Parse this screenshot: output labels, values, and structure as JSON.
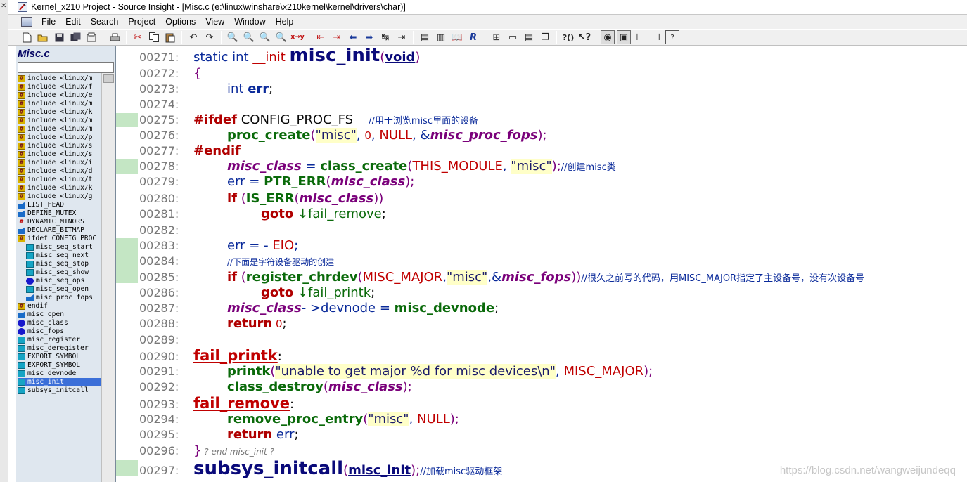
{
  "window": {
    "title": "Kernel_x210 Project - Source Insight - [Misc.c (e:\\linux\\winshare\\x210kernel\\kernel\\drivers\\char)]"
  },
  "menu": [
    "File",
    "Edit",
    "Search",
    "Project",
    "Options",
    "View",
    "Window",
    "Help"
  ],
  "symbol_pane": {
    "file_name": "Misc.c",
    "search_value": "",
    "items": [
      {
        "label": "include <linux/m",
        "icon": "include-icon"
      },
      {
        "label": "include <linux/f",
        "icon": "include-icon"
      },
      {
        "label": "include <linux/e",
        "icon": "include-icon"
      },
      {
        "label": "include <linux/m",
        "icon": "include-icon"
      },
      {
        "label": "include <linux/k",
        "icon": "include-icon"
      },
      {
        "label": "include <linux/m",
        "icon": "include-icon"
      },
      {
        "label": "include <linux/m",
        "icon": "include-icon"
      },
      {
        "label": "include <linux/p",
        "icon": "include-icon"
      },
      {
        "label": "include <linux/s",
        "icon": "include-icon"
      },
      {
        "label": "include <linux/s",
        "icon": "include-icon"
      },
      {
        "label": "include <linux/i",
        "icon": "include-icon"
      },
      {
        "label": "include <linux/d",
        "icon": "include-icon"
      },
      {
        "label": "include <linux/t",
        "icon": "include-icon"
      },
      {
        "label": "include <linux/k",
        "icon": "include-icon"
      },
      {
        "label": "include <linux/g",
        "icon": "include-icon"
      },
      {
        "label": "LIST_HEAD",
        "icon": "macro-icon"
      },
      {
        "label": "DEFINE_MUTEX",
        "icon": "macro-icon"
      },
      {
        "label": "DYNAMIC_MINORS",
        "icon": "define-icon"
      },
      {
        "label": "DECLARE_BITMAP",
        "icon": "macro-icon"
      },
      {
        "label": "ifdef CONFIG_PROC",
        "icon": "include-icon"
      },
      {
        "label": "misc_seq_start",
        "icon": "function-icon",
        "indent": true
      },
      {
        "label": "misc_seq_next",
        "icon": "function-icon",
        "indent": true
      },
      {
        "label": "misc_seq_stop",
        "icon": "function-icon",
        "indent": true
      },
      {
        "label": "misc_seq_show",
        "icon": "function-icon",
        "indent": true
      },
      {
        "label": "misc_seq_ops",
        "icon": "variable-icon",
        "indent": true
      },
      {
        "label": "misc_seq_open",
        "icon": "function-icon",
        "indent": true
      },
      {
        "label": "misc_proc_fops",
        "icon": "macro-icon",
        "indent": true
      },
      {
        "label": "endif",
        "icon": "include-icon"
      },
      {
        "label": "misc_open",
        "icon": "macro-icon"
      },
      {
        "label": "misc_class",
        "icon": "variable-icon"
      },
      {
        "label": "misc_fops",
        "icon": "variable-icon"
      },
      {
        "label": "misc_register",
        "icon": "function-icon"
      },
      {
        "label": "misc_deregister",
        "icon": "function-icon"
      },
      {
        "label": "EXPORT_SYMBOL",
        "icon": "function-icon"
      },
      {
        "label": "EXPORT_SYMBOL",
        "icon": "function-icon"
      },
      {
        "label": "misc_devnode",
        "icon": "function-icon"
      },
      {
        "label": "misc_init",
        "icon": "function-icon",
        "selected": true
      },
      {
        "label": "subsys_initcall",
        "icon": "function-icon"
      }
    ]
  },
  "code": {
    "l271": {
      "n": "00271:",
      "a": "static int ",
      "b": "__init ",
      "c": "misc_init",
      "d": "(",
      "e": "void",
      "f": ")"
    },
    "l272": {
      "n": "00272:",
      "a": "{"
    },
    "l273": {
      "n": "00273:",
      "a": "int ",
      "b": "err",
      "c": ";"
    },
    "l274": {
      "n": "00274:"
    },
    "l275": {
      "n": "00275:",
      "a": "#ifdef",
      "b": " CONFIG_PROC_FS",
      "c": "//用于浏览misc里面的设备"
    },
    "l276": {
      "n": "00276:",
      "a": "proc_create",
      "b": "(",
      "c": "\"misc\"",
      "d": ", ",
      "e": "0",
      "f": ", ",
      "g": "NULL",
      "h": ", &",
      "i": "misc_proc_fops",
      "j": ");"
    },
    "l277": {
      "n": "00277:",
      "a": "#endif"
    },
    "l278": {
      "n": "00278:",
      "a": "misc_class",
      "b": " = ",
      "c": "class_create",
      "d": "(",
      "e": "THIS_MODULE",
      "f": ", ",
      "g": "\"misc\"",
      "h": ");",
      "i": "//创建misc类"
    },
    "l279": {
      "n": "00279:",
      "a": "err",
      "b": " = ",
      "c": "PTR_ERR",
      "d": "(",
      "e": "misc_class",
      "f": ");"
    },
    "l280": {
      "n": "00280:",
      "a": "if",
      "b": " (",
      "c": "IS_ERR",
      "d": "(",
      "e": "misc_class",
      "f": "))"
    },
    "l281": {
      "n": "00281:",
      "a": "goto",
      "b": " ↓fail_remove",
      "c": ";"
    },
    "l282": {
      "n": "00282:"
    },
    "l283": {
      "n": "00283:",
      "a": "err",
      "b": " = - ",
      "c": "EIO",
      "d": ";"
    },
    "l284": {
      "n": "00284:",
      "a": "//下面是字符设备驱动的创建"
    },
    "l285": {
      "n": "00285:",
      "a": "if",
      "b": " (",
      "c": "register_chrdev",
      "d": "(",
      "e": "MISC_MAJOR",
      "f": ",",
      "g": "\"misc\"",
      "h": ",&",
      "i": "misc_fops",
      "j": "))",
      "k": "//很久之前写的代码，用MISC_MAJOR指定了主设备号，没有次设备号"
    },
    "l286": {
      "n": "00286:",
      "a": "goto",
      "b": " ↓fail_printk",
      "c": ";"
    },
    "l287": {
      "n": "00287:",
      "a": "misc_class",
      "b": "- >devnode = ",
      "c": "misc_devnode",
      "d": ";"
    },
    "l288": {
      "n": "00288:",
      "a": "return",
      "b": " 0",
      "c": ";"
    },
    "l289": {
      "n": "00289:"
    },
    "l290": {
      "n": "00290:",
      "a": "fail_printk",
      "b": ":"
    },
    "l291": {
      "n": "00291:",
      "a": "printk",
      "b": "(",
      "c": "\"unable to get major %d for misc devices\\n\"",
      "d": ", ",
      "e": "MISC_MAJOR",
      "f": ");"
    },
    "l292": {
      "n": "00292:",
      "a": "class_destroy",
      "b": "(",
      "c": "misc_class",
      "d": ");"
    },
    "l293": {
      "n": "00293:",
      "a": "fail_remove",
      "b": ":"
    },
    "l294": {
      "n": "00294:",
      "a": "remove_proc_entry",
      "b": "(",
      "c": "\"misc\"",
      "d": ", ",
      "e": "NULL",
      "f": ");"
    },
    "l295": {
      "n": "00295:",
      "a": "return",
      "b": " err",
      "c": ";"
    },
    "l296": {
      "n": "00296:",
      "a": "}",
      "b": " ? end misc_init ?"
    },
    "l297": {
      "n": "00297:",
      "a": "subsys_initcall",
      "b": "(",
      "c": "misc_init",
      "d": ");",
      "e": "//加载misc驱动框架"
    }
  },
  "watermark": "https://blog.csdn.net/wangweijundeqq"
}
